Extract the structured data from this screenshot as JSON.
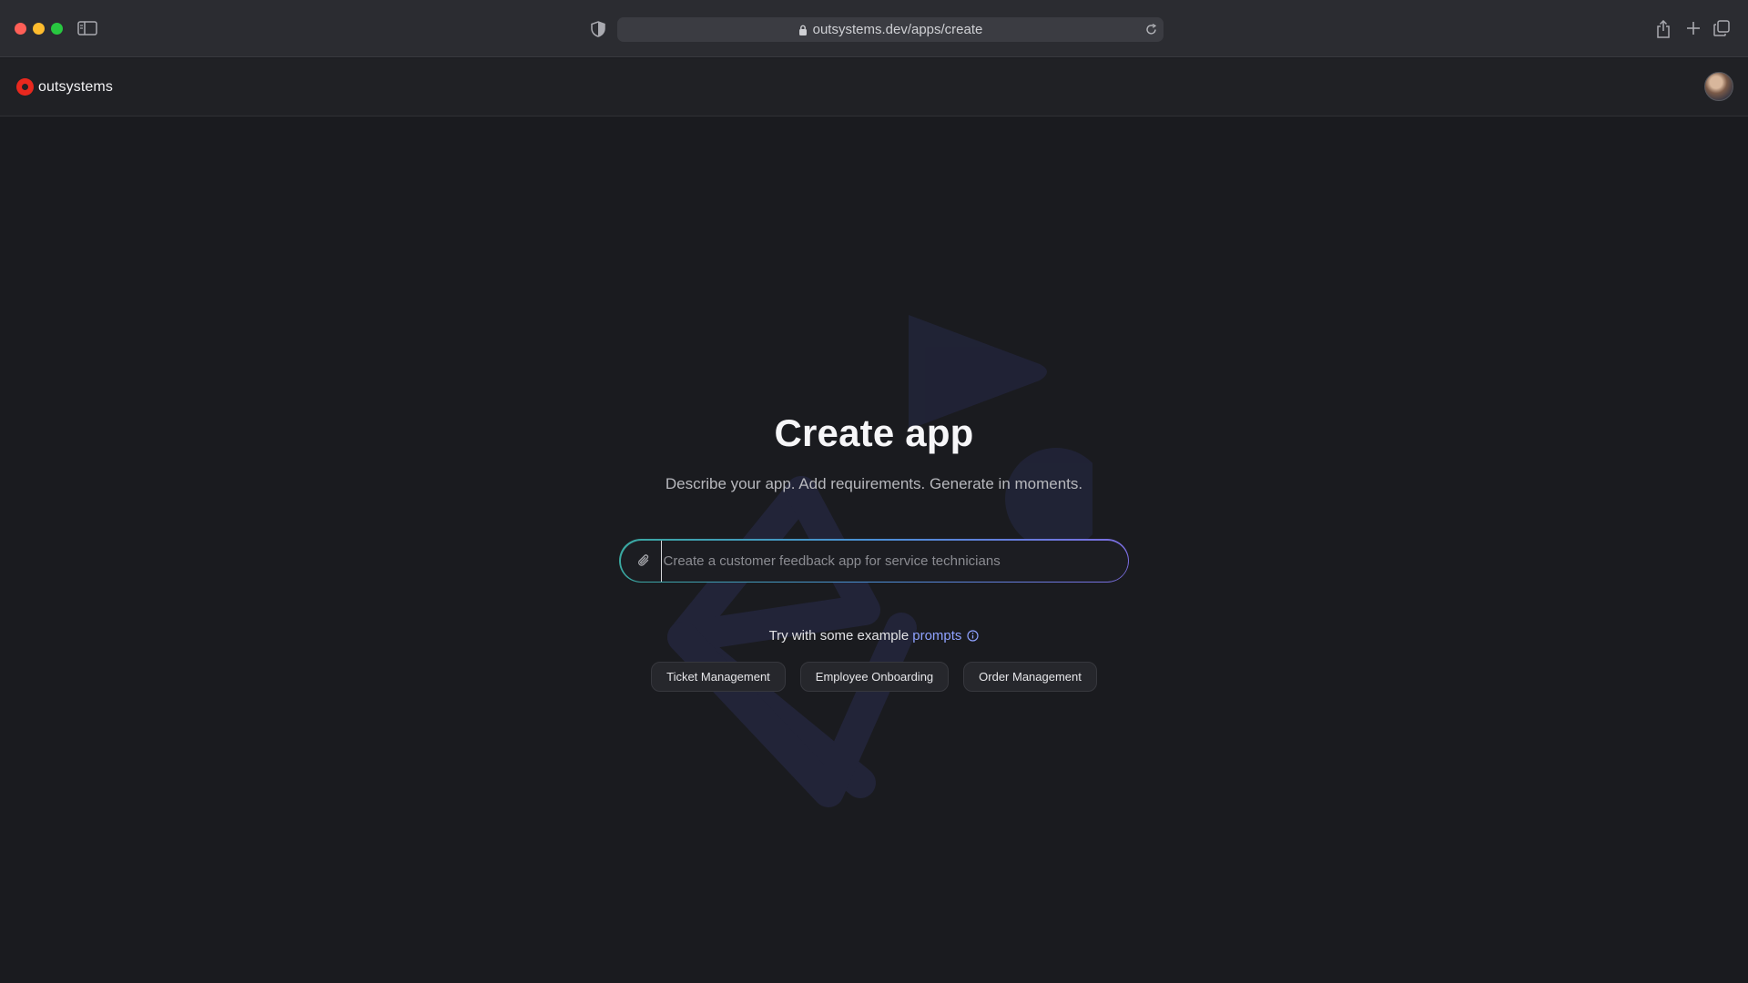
{
  "browser": {
    "url": "outsystems.dev/apps/create"
  },
  "header": {
    "brand": "outsystems"
  },
  "main": {
    "title": "Create app",
    "subtitle": "Describe your app. Add requirements. Generate in moments.",
    "prompt_input": {
      "placeholder": "Create a customer feedback app for service technicians",
      "value": ""
    },
    "examples": {
      "intro": "Try with some example",
      "link_label": "prompts",
      "chips": [
        "Ticket Management",
        "Employee Onboarding",
        "Order Management"
      ]
    }
  },
  "icons": {
    "sidebar_toggle": "sidebar-toggle-icon",
    "shield": "shield-icon",
    "lock": "lock-icon",
    "reload": "reload-icon",
    "share": "share-icon",
    "new_tab": "plus-icon",
    "tab_overview": "tabs-icon",
    "attach": "paperclip-icon",
    "info": "info-icon"
  },
  "colors": {
    "brand_red": "#e8281e",
    "link": "#8fa2ff",
    "background": "#1a1b1f"
  }
}
